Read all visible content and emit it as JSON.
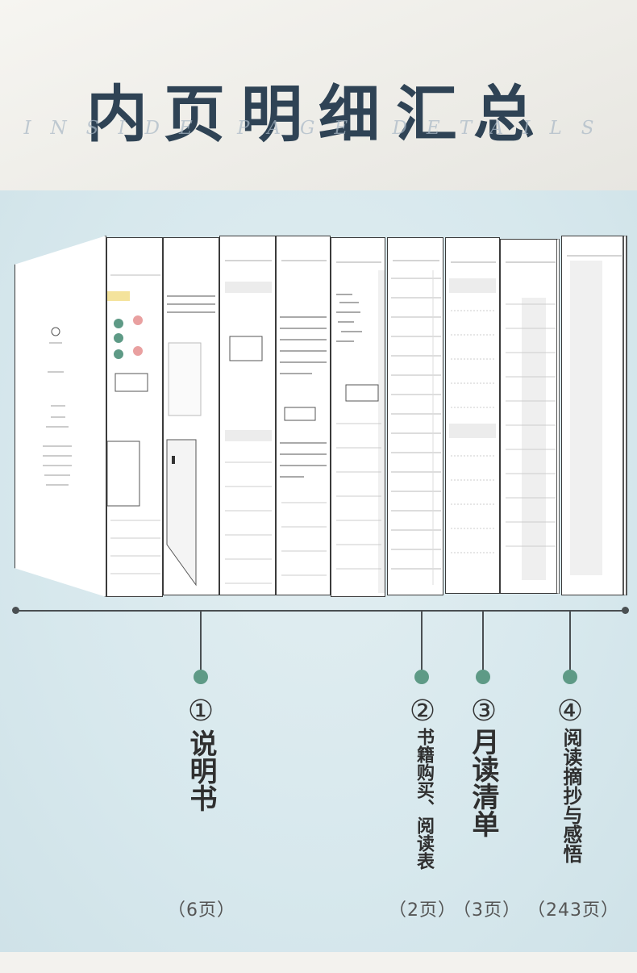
{
  "header": {
    "title": "内页明细汇总",
    "subtitle": "INSIDE PAGE DETAILS"
  },
  "sections": [
    {
      "number": "①",
      "title": "说明书",
      "count": "（6页）"
    },
    {
      "number": "②",
      "title": "书籍购买、阅读表",
      "count": "（2页）"
    },
    {
      "number": "③",
      "title": "月读清单",
      "count": "（3页）"
    },
    {
      "number": "④",
      "title": "阅读摘抄与感悟",
      "count": "（243页）"
    }
  ],
  "colors": {
    "title": "#2f4355",
    "accent_green": "#5e9a86",
    "line": "#4a4f52",
    "background": "#d7e8ed"
  }
}
